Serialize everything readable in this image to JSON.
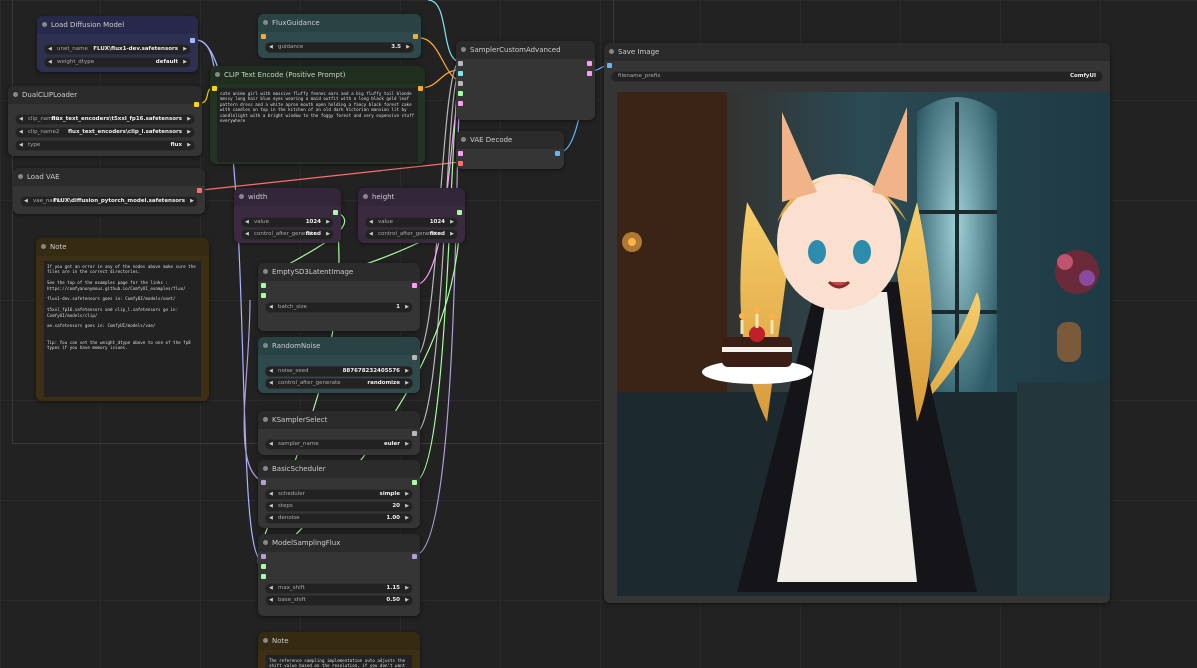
{
  "nodes": {
    "load_diffusion": {
      "title": "Load Diffusion Model",
      "unet_label": "unet_name",
      "unet_value": "FLUX\\flux1-dev.safetensors",
      "dtype_label": "weight_dtype",
      "dtype_value": "default"
    },
    "dual_clip": {
      "title": "DualCLIPLoader",
      "clip1_label": "clip_name1",
      "clip1_value": "flux_text_encoders\\t5xxl_fp16.safetensors",
      "clip2_label": "clip_name2",
      "clip2_value": "flux_text_encoders\\clip_l.safetensors",
      "type_label": "type",
      "type_value": "flux"
    },
    "load_vae": {
      "title": "Load VAE",
      "vae_label": "vae_name",
      "vae_value": "FLUX\\diffusion_pytorch_model.safetensors"
    },
    "note1": {
      "title": "Note",
      "text": "If you get an error in any of the nodes above make sure the files are in the correct directories.\n\nSee the top of the examples page for the links : https://comfyanonymous.github.io/ComfyUI_examples/flux/\n\nflux1-dev.safetensors goes in: ComfyUI/models/unet/\n\nt5xxl_fp16.safetensors and clip_l.safetensors go in: ComfyUI/models/clip/\n\nae.safetensors goes in: ComfyUI/models/vae/\n\n\nTip: You can set the weight_dtype above to one of the fp8 types if you have memory issues."
    },
    "flux_guidance": {
      "title": "FluxGuidance",
      "label": "guidance",
      "value": "3.5"
    },
    "clip_text": {
      "title": "CLIP Text Encode (Positive Prompt)",
      "text": "cute anime girl with massive fluffy fennec ears and a big fluffy tail blonde messy long hair blue eyes wearing a maid outfit with a long black gold leaf pattern dress and a white apron mouth open holding a fancy black forest cake with candles on top in the kitchen of an old dark Victorian mansion lit by candlelight with a bright window to the foggy forest and very expensive stuff everywhere"
    },
    "width": {
      "title": "width",
      "value_label": "value",
      "value": "1024",
      "control_label": "control_after_generate",
      "control_value": "fixed"
    },
    "height": {
      "title": "height",
      "value_label": "value",
      "value": "1024",
      "control_label": "control_after_generate",
      "control_value": "fixed"
    },
    "empty_latent": {
      "title": "EmptySD3LatentImage",
      "batch_label": "batch_size",
      "batch_value": "1"
    },
    "random_noise": {
      "title": "RandomNoise",
      "seed_label": "noise_seed",
      "seed_value": "887678232405576",
      "control_label": "control_after_generate",
      "control_value": "randomize"
    },
    "ksampler_select": {
      "title": "KSamplerSelect",
      "sampler_label": "sampler_name",
      "sampler_value": "euler"
    },
    "basic_scheduler": {
      "title": "BasicScheduler",
      "scheduler_label": "scheduler",
      "scheduler_value": "simple",
      "steps_label": "steps",
      "steps_value": "20",
      "denoise_label": "denoise",
      "denoise_value": "1.00"
    },
    "model_sampling": {
      "title": "ModelSamplingFlux",
      "max_label": "max_shift",
      "max_value": "1.15",
      "base_label": "base_shift",
      "base_value": "0.50"
    },
    "note2": {
      "title": "Note",
      "text": "The reference sampling implementation auto adjusts the shift value based on the resolution, if you don't want"
    },
    "sampler_advanced": {
      "title": "SamplerCustomAdvanced"
    },
    "vae_decode": {
      "title": "VAE Decode"
    },
    "save_image": {
      "title": "Save Image",
      "prefix_label": "filename_prefix",
      "prefix_value": "ComfyUI"
    }
  },
  "colors": {
    "canvas": "#222222",
    "node": "#353535",
    "clip_node": "#233323",
    "int_node": "#3a2a40",
    "note": "#3c2f14",
    "model_node": "#2a2e48",
    "teal": "#2f4a4c"
  }
}
